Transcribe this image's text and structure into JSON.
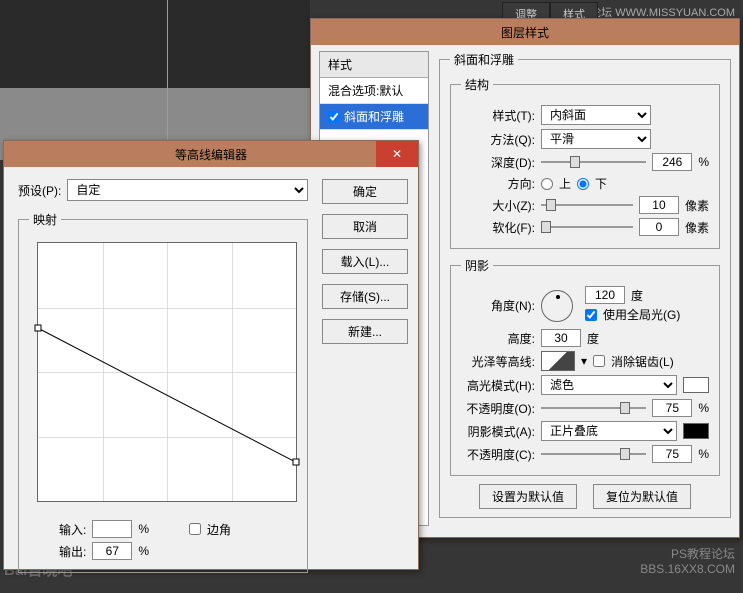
{
  "watermarks": {
    "top_right": "思缘设计论坛  WWW.MISSYUAN.COM",
    "bottom_left": "Bai百晓吧",
    "ps_forum": "PS教程论坛",
    "bbs": "BBS.16XX8.COM"
  },
  "top_tabs": {
    "adjust": "调整",
    "style": "样式"
  },
  "layerstyle": {
    "title": "图层样式",
    "left": {
      "header": "样式",
      "blend_defaults": "混合选项:默认",
      "bevel": "斜面和浮雕"
    },
    "bevel_section": {
      "group_title": "斜面和浮雕",
      "structure": "结构",
      "style_lbl": "样式(T):",
      "style_val": "内斜面",
      "technique_lbl": "方法(Q):",
      "technique_val": "平滑",
      "depth_lbl": "深度(D):",
      "depth_val": "246",
      "pct": "%",
      "direction_lbl": "方向:",
      "dir_up": "上",
      "dir_down": "下",
      "size_lbl": "大小(Z):",
      "size_val": "10",
      "px": "像素",
      "soften_lbl": "软化(F):",
      "soften_val": "0"
    },
    "shading": {
      "title": "阴影",
      "angle_lbl": "角度(N):",
      "angle_val": "120",
      "deg": "度",
      "global_light": "使用全局光(G)",
      "altitude_lbl": "高度:",
      "altitude_val": "30",
      "gloss_lbl": "光泽等高线:",
      "anti_alias": "消除锯齿(L)",
      "highlight_mode_lbl": "高光模式(H):",
      "highlight_mode_val": "滤色",
      "opacity_lbl_o": "不透明度(O):",
      "opacity_o_val": "75",
      "shadow_mode_lbl": "阴影模式(A):",
      "shadow_mode_val": "正片叠底",
      "opacity_lbl_c": "不透明度(C):",
      "opacity_c_val": "75"
    },
    "buttons": {
      "make_default": "设置为默认值",
      "reset_default": "复位为默认值"
    }
  },
  "contour": {
    "title": "等高线编辑器",
    "preset_lbl": "预设(P):",
    "preset_val": "自定",
    "mapping": "映射",
    "buttons": {
      "ok": "确定",
      "cancel": "取消",
      "load": "载入(L)...",
      "save": "存储(S)...",
      "new": "新建..."
    },
    "input_lbl": "输入:",
    "input_val": "",
    "pct": "%",
    "corner": "边角",
    "output_lbl": "输出:",
    "output_val": "67"
  }
}
